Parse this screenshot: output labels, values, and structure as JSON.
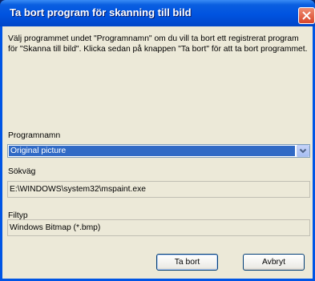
{
  "window": {
    "title": "Ta bort program för skanning till bild"
  },
  "description": "Välj programmet undet \"Programnamn\" om du vill ta bort ett registrerat program för \"Skanna till bild\". Klicka sedan på knappen \"Ta bort\" för att ta bort programmet.",
  "program": {
    "label": "Programnamn",
    "selected": "Original picture"
  },
  "path": {
    "label": "Sökväg",
    "value": "E:\\WINDOWS\\system32\\mspaint.exe"
  },
  "filetype": {
    "label": "Filtyp",
    "value": "Windows Bitmap (*.bmp)"
  },
  "buttons": {
    "remove": "Ta bort",
    "cancel": "Avbryt"
  },
  "colors": {
    "titlebar": "#0053e0",
    "client": "#ece9d8",
    "selection": "#316ac5",
    "close": "#d8452a"
  },
  "icons": {
    "close": "close-icon",
    "dropdown": "chevron-down-icon"
  }
}
